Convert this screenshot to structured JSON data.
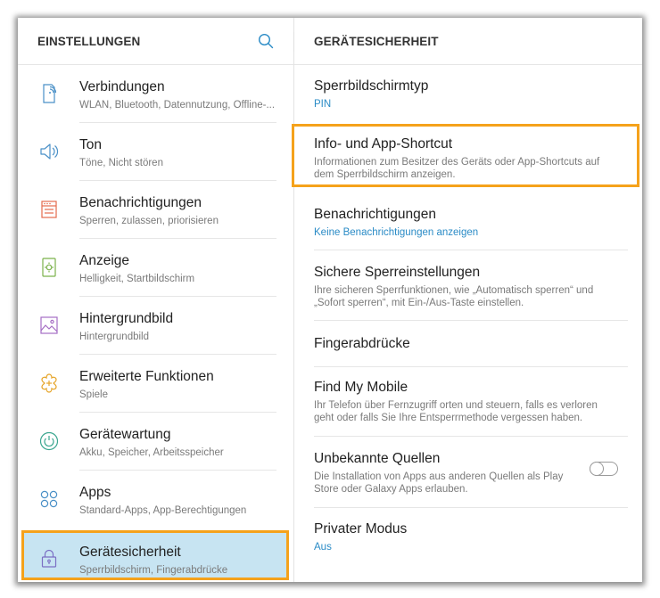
{
  "left": {
    "title": "EINSTELLUNGEN",
    "items": [
      {
        "label": "Verbindungen",
        "sub": "WLAN, Bluetooth, Datennutzung, Offline-...",
        "icon": "connections-icon",
        "color": "#4a90c7"
      },
      {
        "label": "Ton",
        "sub": "Töne, Nicht stören",
        "icon": "speaker-icon",
        "color": "#4a90c7"
      },
      {
        "label": "Benachrichtigungen",
        "sub": "Sperren, zulassen, priorisieren",
        "icon": "notifications-icon",
        "color": "#e46a4d"
      },
      {
        "label": "Anzeige",
        "sub": "Helligkeit, Startbildschirm",
        "icon": "display-icon",
        "color": "#7bb24b"
      },
      {
        "label": "Hintergrundbild",
        "sub": "Hintergrundbild",
        "icon": "wallpaper-icon",
        "color": "#a56dc4"
      },
      {
        "label": "Erweiterte Funktionen",
        "sub": "Spiele",
        "icon": "advanced-features-icon",
        "color": "#e6a52a"
      },
      {
        "label": "Gerätewartung",
        "sub": "Akku, Speicher, Arbeitsspeicher",
        "icon": "device-maintenance-icon",
        "color": "#3aa68f"
      },
      {
        "label": "Apps",
        "sub": "Standard-Apps, App-Berechtigungen",
        "icon": "apps-icon",
        "color": "#4a90c7"
      },
      {
        "label": "Gerätesicherheit",
        "sub": "Sperrbildschirm, Fingerabdrücke",
        "icon": "lock-icon",
        "color": "#7b6fc4"
      }
    ]
  },
  "right": {
    "title": "GERÄTESICHERHEIT",
    "rows": [
      {
        "title": "Sperrbildschirmtyp",
        "desc": "PIN",
        "desc_style": "blue"
      },
      {
        "title": "Info- und App-Shortcut",
        "desc": "Informationen zum Besitzer des Geräts oder App-Shortcuts auf dem Sperrbildschirm anzeigen.",
        "desc_style": "gray"
      },
      {
        "title": "Benachrichtigungen",
        "desc": "Keine Benachrichtigungen anzeigen",
        "desc_style": "blue"
      },
      {
        "title": "Sichere Sperreinstellungen",
        "desc": "Ihre sicheren Sperrfunktionen, wie „Automatisch sperren“ und „Sofort sperren“, mit Ein-/Aus-Taste einstellen.",
        "desc_style": "gray"
      },
      {
        "title": "Fingerabdrücke",
        "desc": "",
        "desc_style": "gray"
      },
      {
        "title": "Find My Mobile",
        "desc": "Ihr Telefon über Fernzugriff orten und steuern, falls es verloren geht oder falls Sie Ihre Entsperrmethode vergessen haben.",
        "desc_style": "gray"
      },
      {
        "title": "Unbekannte Quellen",
        "desc": "Die Installation von Apps aus anderen Quellen als Play Store oder Galaxy Apps erlauben.",
        "desc_style": "gray",
        "toggle": "off"
      },
      {
        "title": "Privater Modus",
        "desc": "Aus",
        "desc_style": "blue"
      }
    ]
  },
  "colors": {
    "highlight": "#f5a21b",
    "active_bg": "#c7e4f2",
    "link_blue": "#2a8bc6"
  }
}
